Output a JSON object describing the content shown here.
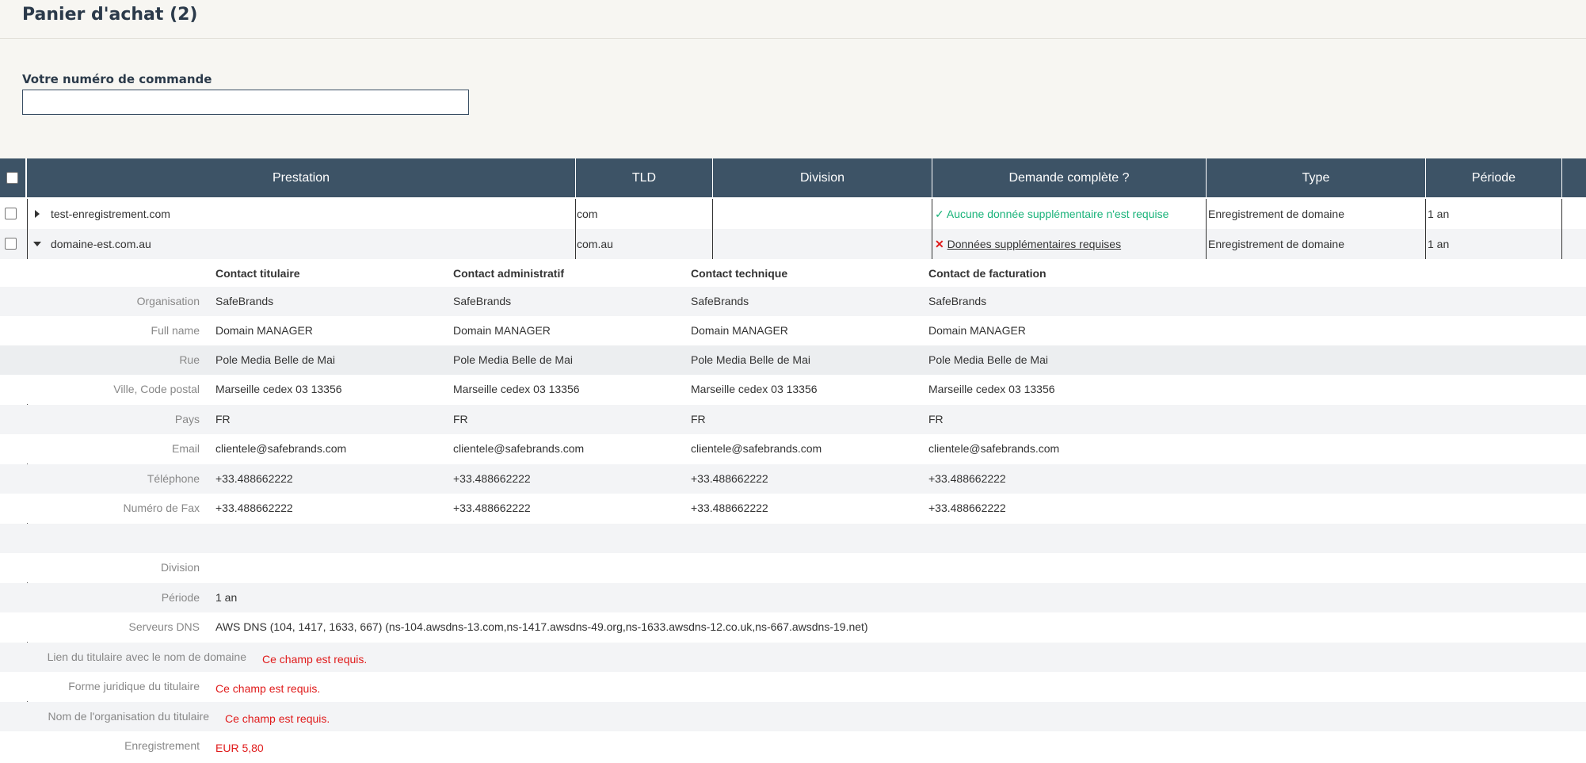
{
  "page": {
    "title": "Panier d'achat  (2)"
  },
  "order": {
    "label": "Votre numéro de commande",
    "value": ""
  },
  "table": {
    "headers": [
      "Prestation",
      "TLD",
      "Division",
      "Demande complète ?",
      "Type",
      "Période"
    ],
    "rows": [
      {
        "prestation": "test-enregistrement.com",
        "tld": "com",
        "division": "",
        "status_icon": "✓",
        "status": "Aucune donnée supplémentaire n'est requise",
        "type": "Enregistrement de domaine",
        "periode": "1 an"
      },
      {
        "prestation": "domaine-est.com.au",
        "tld": "com.au",
        "division": "",
        "status_icon": "✕",
        "status": "Données supplémentaires requises",
        "type": "Enregistrement de domaine",
        "periode": "1 an"
      }
    ]
  },
  "contacts": {
    "headers": [
      "Contact titulaire",
      "Contact administratif",
      "Contact technique",
      "Contact de facturation"
    ],
    "rows": [
      {
        "label": "Organisation",
        "values": [
          "SafeBrands",
          "SafeBrands",
          "SafeBrands",
          "SafeBrands"
        ]
      },
      {
        "label": "Full name",
        "values": [
          "Domain MANAGER",
          "Domain MANAGER",
          "Domain MANAGER",
          "Domain MANAGER"
        ]
      },
      {
        "label": "Rue",
        "values": [
          "Pole Media Belle de Mai",
          "Pole Media Belle de Mai",
          "Pole Media Belle de Mai",
          "Pole Media Belle de Mai"
        ]
      },
      {
        "label": "Ville, Code postal",
        "values": [
          "Marseille cedex 03 13356",
          "Marseille cedex 03 13356",
          "Marseille cedex 03 13356",
          "Marseille cedex 03 13356"
        ]
      },
      {
        "label": "Pays",
        "values": [
          "FR",
          "FR",
          "FR",
          "FR"
        ]
      },
      {
        "label": "Email",
        "values": [
          "clientele@safebrands.com",
          "clientele@safebrands.com",
          "clientele@safebrands.com",
          "clientele@safebrands.com"
        ]
      },
      {
        "label": "Téléphone",
        "values": [
          "+33.488662222",
          "+33.488662222",
          "+33.488662222",
          "+33.488662222"
        ]
      },
      {
        "label": "Numéro de Fax",
        "values": [
          "+33.488662222",
          "+33.488662222",
          "+33.488662222",
          "+33.488662222"
        ]
      }
    ]
  },
  "details": [
    {
      "label": "Division",
      "value": ""
    },
    {
      "label": "Période",
      "value": "1 an"
    },
    {
      "label": "Serveurs DNS",
      "value": "AWS DNS (104, 1417, 1633, 667) (ns-104.awsdns-13.com,ns-1417.awsdns-49.org,ns-1633.awsdns-12.co.uk,ns-667.awsdns-19.net)"
    },
    {
      "label": "Lien du titulaire avec le nom de domaine",
      "value": "Ce champ est requis."
    },
    {
      "label": "Forme juridique du titulaire",
      "value": "Ce champ est requis."
    },
    {
      "label": "Nom de l'organisation du titulaire",
      "value": "Ce champ est requis."
    },
    {
      "label": "Enregistrement",
      "value": "EUR 5,80"
    }
  ],
  "colors": {
    "header_bg": "#3d5366",
    "ok": "#1ab37a",
    "error": "#e01b1b"
  }
}
